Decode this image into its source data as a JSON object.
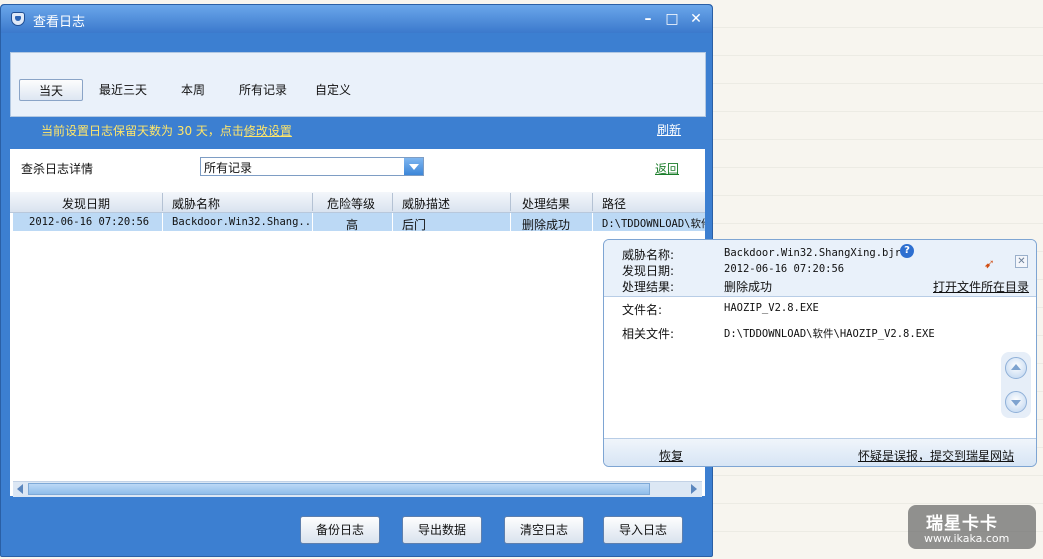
{
  "window": {
    "title": "查看日志"
  },
  "tabs": [
    {
      "label": "当天",
      "active": true
    },
    {
      "label": "最近三天"
    },
    {
      "label": "本周"
    },
    {
      "label": "所有记录"
    },
    {
      "label": "自定义"
    }
  ],
  "info": {
    "prefix": "当前设置日志保留天数为 30 天，点击",
    "link": "修改设置",
    "refresh": "刷新"
  },
  "filter": {
    "label": "查杀日志详情",
    "selected": "所有记录",
    "back": "返回"
  },
  "table": {
    "headers": [
      "发现日期",
      "威胁名称",
      "危险等级",
      "威胁描述",
      "处理结果",
      "路径"
    ],
    "rows": [
      [
        "2012-06-16 07:20:56",
        "Backdoor.Win32.Shang...",
        "高",
        "后门",
        "删除成功",
        "D:\\TDDOWNLOAD\\软件"
      ]
    ]
  },
  "buttons": {
    "backup": "备份日志",
    "export": "导出数据",
    "clear": "清空日志",
    "import": "导入日志"
  },
  "popup": {
    "threat_label": "威胁名称:",
    "threat_value": "Backdoor.Win32.ShangXing.bjr",
    "date_label": "发现日期:",
    "date_value": "2012-06-16 07:20:56",
    "result_label": "处理结果:",
    "result_value": "删除成功",
    "open_folder": "打开文件所在目录",
    "file_label": "文件名:",
    "file_value": "HAOZIP_V2.8.EXE",
    "related_label": "相关文件:",
    "related_value": "D:\\TDDOWNLOAD\\软件\\HAOZIP_V2.8.EXE",
    "restore": "恢复",
    "report": "怀疑是误报，提交到瑞星网站",
    "help_glyph": "?",
    "close_glyph": "✕"
  },
  "watermark": {
    "line1": "瑞星卡卡",
    "line2": "www.ikaka.com"
  },
  "icons": {
    "minimize": "–",
    "maximize": "□",
    "close": "✕",
    "pin": "➹"
  }
}
